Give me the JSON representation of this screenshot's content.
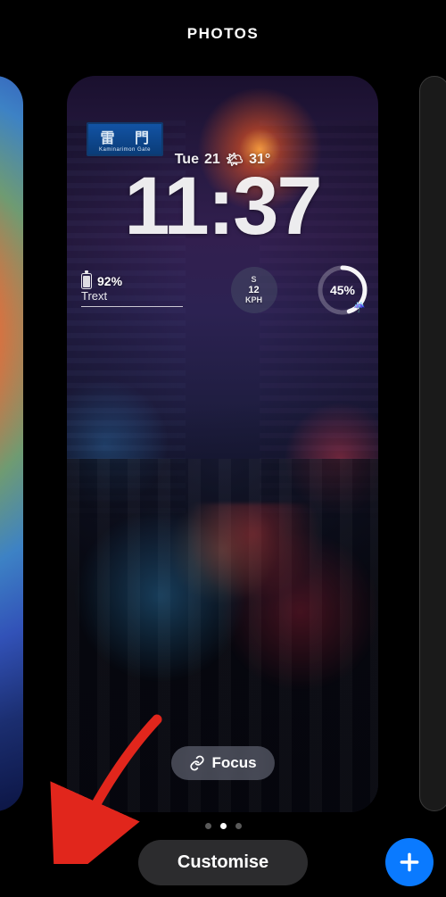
{
  "header": {
    "title": "PHOTOS"
  },
  "lockscreen": {
    "date_day": "Tue",
    "date_num": "21",
    "weather_glyph": "🌤",
    "temp": "31°",
    "time": "11:37",
    "sign_roman": "Kaminarimon Gate",
    "sign_kanji_left": "雷",
    "sign_kanji_right": "門",
    "widgets": {
      "battery": {
        "percent": "92%",
        "label": "Trext"
      },
      "wind": {
        "dir": "S",
        "speed": "12",
        "unit": "KPH"
      },
      "ring": {
        "label": "45%"
      }
    },
    "focus": {
      "label": "Focus"
    }
  },
  "pager": {
    "count": 3,
    "active": 1
  },
  "actions": {
    "customise": "Customise",
    "add_aria": "Add"
  }
}
